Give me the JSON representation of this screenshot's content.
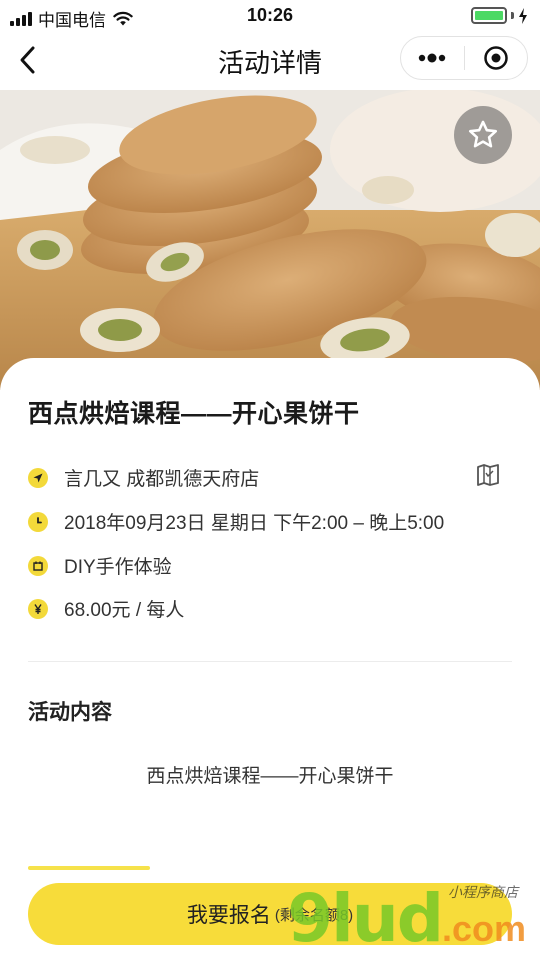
{
  "status_bar": {
    "carrier": "中国电信",
    "time": "10:26"
  },
  "nav": {
    "title": "活动详情",
    "icons": [
      "back-arrow-icon",
      "more-dots-icon",
      "target-close-icon"
    ]
  },
  "hero": {
    "favorite_icon": "star-outline-icon"
  },
  "event": {
    "title": "西点烘焙课程——开心果饼干",
    "location": "言几又 成都凯德天府店",
    "datetime": "2018年09月23日 星期日 下午2:00 – 晚上5:00",
    "category": "DIY手作体验",
    "price": "68.00元 / 每人"
  },
  "content": {
    "section_title": "活动内容",
    "body": "西点烘焙课程——开心果饼干"
  },
  "signup": {
    "label": "我要报名",
    "remaining": "(剩余名额8)"
  },
  "watermark": {
    "main": "9lud",
    "suffix": ".com",
    "small": "小程序商店"
  },
  "colors": {
    "accent_yellow": "#f7dc3a",
    "battery_green": "#4cd964"
  }
}
